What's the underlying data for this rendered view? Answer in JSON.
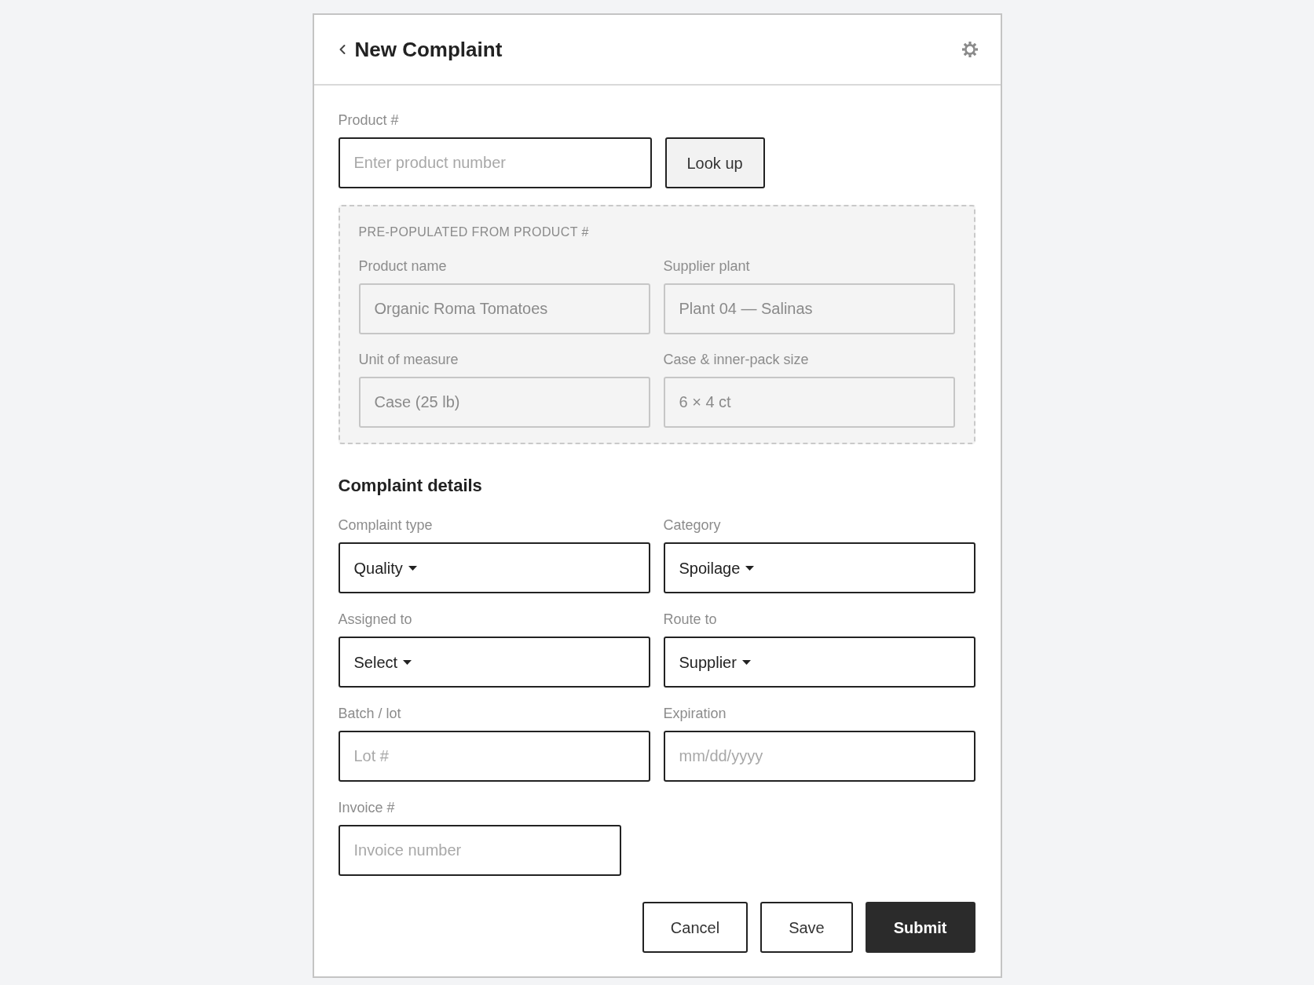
{
  "header": {
    "title": "New Complaint"
  },
  "product_lookup": {
    "label": "Product #",
    "placeholder": "Enter product number",
    "button": "Look up"
  },
  "prepopulated": {
    "caption": "PRE-POPULATED FROM PRODUCT #",
    "fields": [
      {
        "label": "Product name",
        "value": "Organic Roma Tomatoes",
        "disabled": true
      },
      {
        "label": "Supplier plant",
        "value": "Plant 04 — Salinas",
        "disabled": true
      },
      {
        "label": "Unit of measure",
        "value": "Case (25 lb)",
        "disabled": true
      },
      {
        "label": "Case & inner-pack size",
        "value": "6 × 4 ct",
        "disabled": true
      }
    ]
  },
  "complaint_details": {
    "title": "Complaint details",
    "fields": [
      {
        "kind": "select",
        "label": "Complaint type",
        "value": "Quality"
      },
      {
        "kind": "select",
        "label": "Category",
        "value": "Spoilage"
      },
      {
        "kind": "select",
        "label": "Assigned to",
        "value": "Select"
      },
      {
        "kind": "select",
        "label": "Route to",
        "value": "Supplier"
      },
      {
        "kind": "input",
        "label": "Batch / lot",
        "placeholder": "Lot #"
      },
      {
        "kind": "input",
        "label": "Expiration",
        "placeholder": "mm/dd/yyyy"
      }
    ],
    "invoice": {
      "label": "Invoice #",
      "placeholder": "Invoice number"
    }
  },
  "buttons": [
    {
      "label": "Cancel",
      "kind": "secondary"
    },
    {
      "label": "Save",
      "kind": "secondary"
    },
    {
      "label": "Submit",
      "kind": "primary"
    }
  ]
}
